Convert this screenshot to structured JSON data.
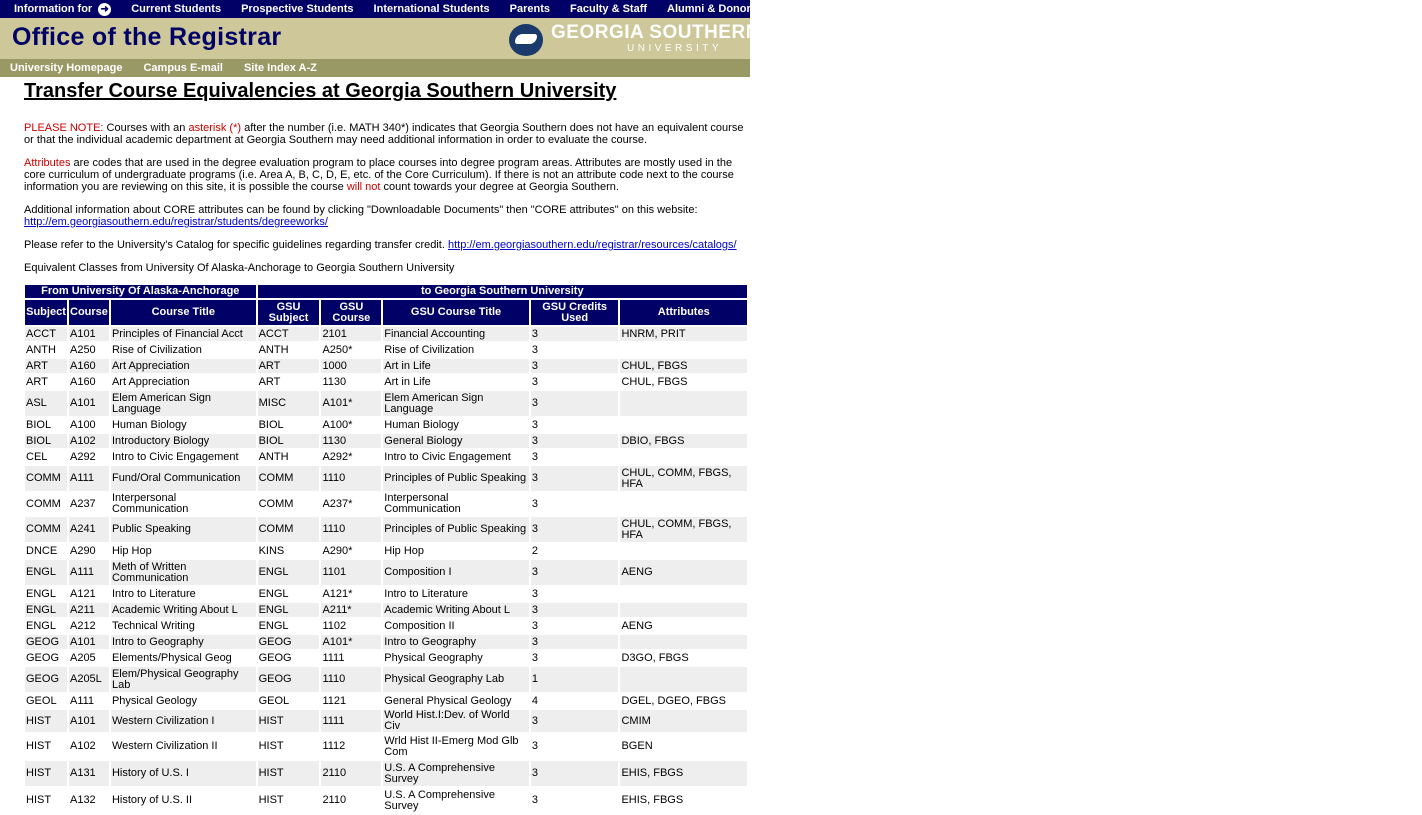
{
  "topnav": {
    "info_label": "Information for",
    "items": [
      "Current Students",
      "Prospective Students",
      "International Students",
      "Parents",
      "Faculty & Staff",
      "Alumni & Donors"
    ]
  },
  "banner": {
    "title": "Office of the Registrar",
    "logo_line1": "GEORGIA SOUTHERN",
    "logo_line2": "UNIVERSITY"
  },
  "subnav": {
    "items": [
      "University Homepage",
      "Campus E-mail",
      "Site Index A-Z"
    ]
  },
  "page_title": "Transfer Course Equivalencies at Georgia Southern University",
  "note": {
    "label": "PLEASE NOTE:",
    "t1": " Courses with an ",
    "asterisk": "asterisk (*)",
    "t2": " after the number (i.e. MATH 340*) indicates that Georgia Southern does not have an equivalent course or that the individual academic department at Georgia Southern may need additional information in order to evaluate the course."
  },
  "attributes_para": {
    "label": "Attributes",
    "t1": " are codes that are used in the degree evaluation program to place courses into degree program areas. Attributes are mostly used in the core curriculum of undergraduate programs (i.e. Area A, B, C, D, E, etc. of the Core Curriculum). If there is not an attribute code next to the course information you are reviewing on this site, it is possible the course ",
    "will_not": "will not",
    "t2": " count towards your degree at Georgia Southern."
  },
  "core_para": {
    "text": "Additional information about CORE attributes can be found by clicking \"Downloadable Documents\" then \"CORE attributes\" on this website:",
    "link": "http://em.georgiasouthern.edu/registrar/students/degreeworks/"
  },
  "catalog_para": {
    "text": "Please refer to the University's Catalog for specific guidelines regarding transfer credit. ",
    "link": "http://em.georgiasouthern.edu/registrar/resources/catalogs/"
  },
  "equiv_caption": "Equivalent Classes from University Of Alaska-Anchorage to Georgia Southern University",
  "table": {
    "group_from": "From University Of Alaska-Anchorage",
    "group_to": "to Georgia Southern University",
    "headers": [
      "Subject",
      "Course",
      "Course Title",
      "GSU Subject",
      "GSU Course",
      "GSU Course Title",
      "GSU Credits Used",
      "Attributes"
    ],
    "rows": [
      [
        "ACCT",
        "A101",
        "Principles of Financial Acct",
        "ACCT",
        "2101",
        "Financial Accounting",
        "3",
        "HNRM, PRIT"
      ],
      [
        "ANTH",
        "A250",
        "Rise of Civilization",
        "ANTH",
        "A250*",
        "Rise of Civilization",
        "3",
        ""
      ],
      [
        "ART",
        "A160",
        "Art Appreciation",
        "ART",
        "1000",
        "Art in Life",
        "3",
        "CHUL, FBGS"
      ],
      [
        "ART",
        "A160",
        "Art Appreciation",
        "ART",
        "1130",
        "Art in Life",
        "3",
        "CHUL, FBGS"
      ],
      [
        "ASL",
        "A101",
        "Elem American Sign Language",
        "MISC",
        "A101*",
        "Elem American Sign Language",
        "3",
        ""
      ],
      [
        "BIOL",
        "A100",
        "Human Biology",
        "BIOL",
        "A100*",
        "Human Biology",
        "3",
        ""
      ],
      [
        "BIOL",
        "A102",
        "Introductory Biology",
        "BIOL",
        "1130",
        "General Biology",
        "3",
        "DBIO, FBGS"
      ],
      [
        "CEL",
        "A292",
        "Intro to Civic Engagement",
        "ANTH",
        "A292*",
        "Intro to Civic Engagement",
        "3",
        ""
      ],
      [
        "COMM",
        "A111",
        "Fund/Oral Communication",
        "COMM",
        "1110",
        "Principles of Public Speaking",
        "3",
        "CHUL, COMM, FBGS, HFA"
      ],
      [
        "COMM",
        "A237",
        "Interpersonal Communication",
        "COMM",
        "A237*",
        "Interpersonal Communication",
        "3",
        ""
      ],
      [
        "COMM",
        "A241",
        "Public Speaking",
        "COMM",
        "1110",
        "Principles of Public Speaking",
        "3",
        "CHUL, COMM, FBGS, HFA"
      ],
      [
        "DNCE",
        "A290",
        "Hip Hop",
        "KINS",
        "A290*",
        "Hip Hop",
        "2",
        ""
      ],
      [
        "ENGL",
        "A111",
        "Meth of Written Communication",
        "ENGL",
        "1101",
        "Composition I",
        "3",
        "AENG"
      ],
      [
        "ENGL",
        "A121",
        "Intro to Literature",
        "ENGL",
        "A121*",
        "Intro to Literature",
        "3",
        ""
      ],
      [
        "ENGL",
        "A211",
        "Academic Writing About L",
        "ENGL",
        "A211*",
        "Academic Writing About L",
        "3",
        ""
      ],
      [
        "ENGL",
        "A212",
        "Technical Writing",
        "ENGL",
        "1102",
        "Composition II",
        "3",
        "AENG"
      ],
      [
        "GEOG",
        "A101",
        "Intro to Geography",
        "GEOG",
        "A101*",
        "Intro to Geography",
        "3",
        ""
      ],
      [
        "GEOG",
        "A205",
        "Elements/Physical Geog",
        "GEOG",
        "1111",
        "Physical Geography",
        "3",
        "D3GO, FBGS"
      ],
      [
        "GEOG",
        "A205L",
        "Elem/Physical Geography Lab",
        "GEOG",
        "1110",
        "Physical Geography Lab",
        "1",
        ""
      ],
      [
        "GEOL",
        "A111",
        "Physical Geology",
        "GEOL",
        "1121",
        "General Physical Geology",
        "4",
        "DGEL, DGEO, FBGS"
      ],
      [
        "HIST",
        "A101",
        "Western Civilization I",
        "HIST",
        "1111",
        "World Hist.I:Dev. of World Civ",
        "3",
        "CMIM"
      ],
      [
        "HIST",
        "A102",
        "Western Civilization II",
        "HIST",
        "1112",
        "Wrld Hist II-Emerg Mod Glb Com",
        "3",
        "BGEN"
      ],
      [
        "HIST",
        "A131",
        "History of U.S. I",
        "HIST",
        "2110",
        "U.S. A Comprehensive Survey",
        "3",
        "EHIS, FBGS"
      ],
      [
        "HIST",
        "A132",
        "History of U.S. II",
        "HIST",
        "2110",
        "U.S. A Comprehensive Survey",
        "3",
        "EHIS, FBGS"
      ]
    ]
  }
}
